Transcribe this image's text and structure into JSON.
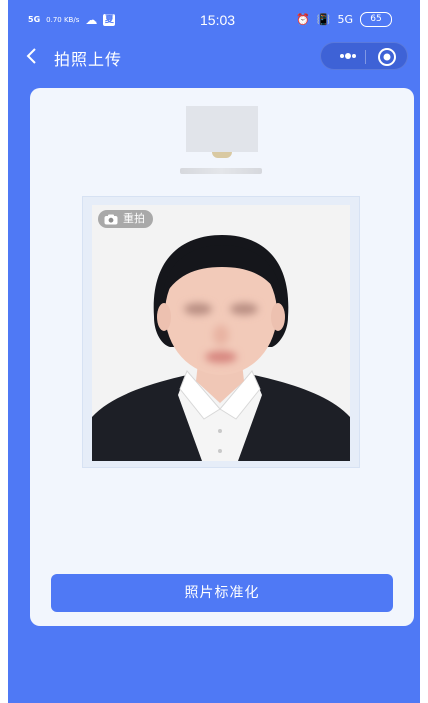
{
  "status_bar": {
    "signal": "5G",
    "net_speed": "0.70 KB/s",
    "time": "15:03",
    "network": "5G",
    "battery": "65"
  },
  "nav": {
    "title": "拍照上传"
  },
  "photo": {
    "retake_label": "重拍"
  },
  "actions": {
    "standardize_label": "照片标准化"
  },
  "colors": {
    "accent": "#4f79f5",
    "card_bg": "#f2f6fd"
  }
}
